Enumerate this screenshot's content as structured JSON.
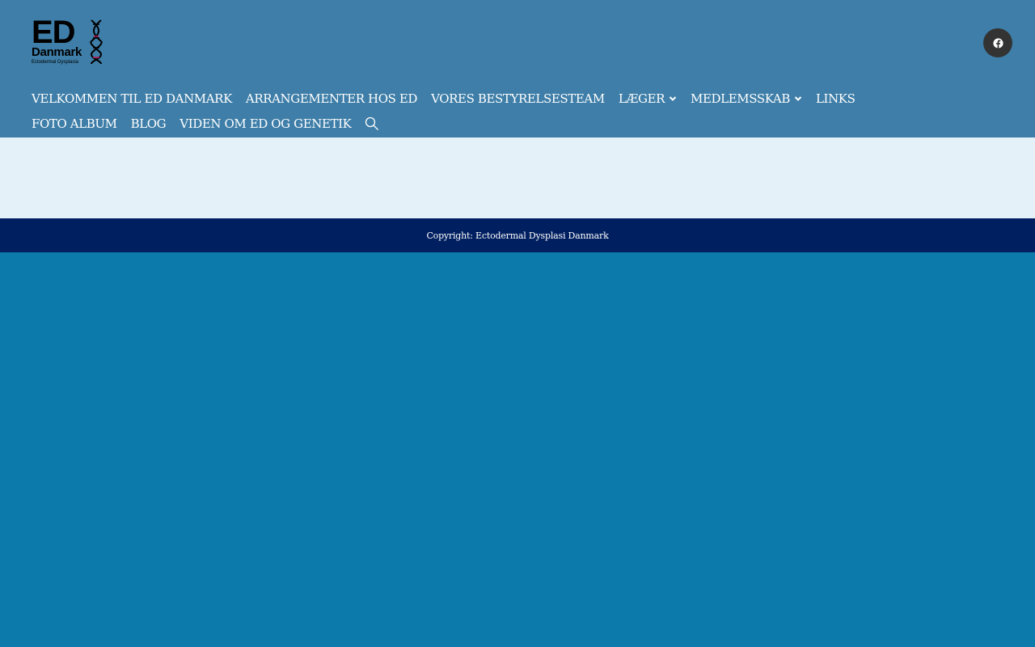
{
  "logo": {
    "main": "ED",
    "name": "Danmark",
    "subtitle": "Ectodermal Dysplasia"
  },
  "social": {
    "icon": "facebook-icon"
  },
  "nav": {
    "items": [
      {
        "label": "VELKOMMEN TIL ED DANMARK",
        "dropdown": false
      },
      {
        "label": "ARRANGEMENTER HOS ED",
        "dropdown": false
      },
      {
        "label": "VORES BESTYRELSESTEAM",
        "dropdown": false
      },
      {
        "label": "LÆGER",
        "dropdown": true
      },
      {
        "label": "MEDLEMSSKAB",
        "dropdown": true
      },
      {
        "label": "LINKS",
        "dropdown": false
      },
      {
        "label": "FOTO ALBUM",
        "dropdown": false
      },
      {
        "label": "BLOG",
        "dropdown": false
      },
      {
        "label": "VIDEN OM ED OG GENETIK",
        "dropdown": false
      }
    ],
    "search_icon": "search-icon"
  },
  "footer": {
    "copyright": "Copyright: Ectodermal Dysplasi Danmark"
  },
  "colors": {
    "header_bg": "#3e7ea8",
    "content_bg": "#e4f1f9",
    "footer_bg": "#001f60",
    "page_bg": "#0c7bab",
    "social_bg": "#333333"
  }
}
